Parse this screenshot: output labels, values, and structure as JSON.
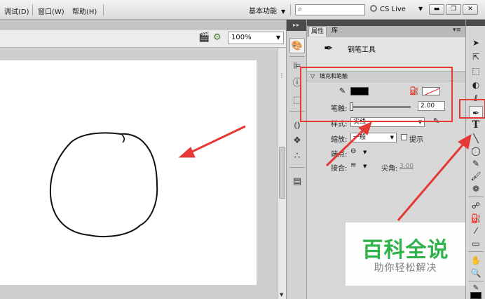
{
  "menu": {
    "items": [
      "调试(D)",
      "窗口(W)",
      "帮助(H)"
    ],
    "workspace": "基本功能",
    "search_placeholder": "",
    "cs_live": "CS Live",
    "window_buttons": [
      "minimize",
      "restore",
      "close"
    ]
  },
  "document": {
    "zoom": "100%",
    "drawing": "hand-drawn closed circle shape"
  },
  "icon_strip": {
    "icons": [
      "color-icon",
      "align-icon",
      "info-icon",
      "transform-icon",
      "code-snippets-icon",
      "components-icon",
      "motion-presets-icon",
      "library-icon"
    ]
  },
  "properties": {
    "tab_properties": "属性",
    "tab_library": "库",
    "tool_name": "钢笔工具",
    "section_title": "填充和笔触",
    "stroke_label": "笔触:",
    "stroke_value": "2.00",
    "style_label": "样式:",
    "style_value": "实线",
    "scale_label": "缩放:",
    "scale_value": "一般",
    "hint_label": "提示",
    "cap_label": "端点:",
    "join_label": "接合:",
    "miter_label": "尖角:",
    "miter_value": "3.00",
    "colors": {
      "stroke": "#000000",
      "fill": "none"
    }
  },
  "tools": {
    "items": [
      "selection-tool",
      "subselection-tool",
      "free-transform-tool",
      "3d-rotation-tool",
      "lasso-tool",
      "pen-tool",
      "text-tool",
      "line-tool",
      "rectangle-tool",
      "pencil-tool",
      "brush-tool",
      "deco-tool",
      "bone-tool",
      "paint-bucket-tool",
      "eyedropper-tool",
      "eraser-tool",
      "hand-tool",
      "zoom-tool",
      "stroke-color",
      "fill-color"
    ],
    "active": "pen-tool"
  },
  "annotations": {
    "highlight_color": "#e53935"
  },
  "watermark": {
    "title": "百科全说",
    "subtitle": "助你轻松解决"
  }
}
